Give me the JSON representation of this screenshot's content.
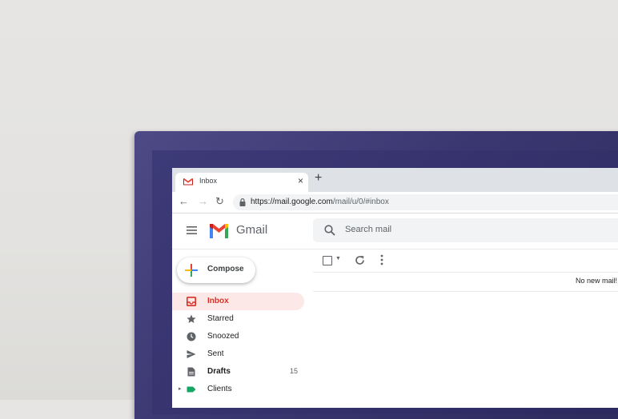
{
  "browser": {
    "tab_title": "Inbox",
    "tab_close": "×",
    "new_tab": "+",
    "url_main": "https://mail.google.com",
    "url_path": "/mail/u/0/#inbox",
    "nav_back": "←",
    "nav_forward": "→",
    "nav_reload": "↻"
  },
  "gmail": {
    "app_name": "Gmail",
    "search_placeholder": "Search mail",
    "compose_label": "Compose",
    "empty_message": "No new mail!"
  },
  "sidebar": {
    "items": [
      {
        "label": "Inbox",
        "icon": "inbox-icon",
        "active": true
      },
      {
        "label": "Starred",
        "icon": "star-icon"
      },
      {
        "label": "Snoozed",
        "icon": "clock-icon"
      },
      {
        "label": "Sent",
        "icon": "send-icon"
      },
      {
        "label": "Drafts",
        "icon": "draft-icon",
        "count": "15"
      },
      {
        "label": "Clients",
        "icon": "label-icon",
        "expand": "▸"
      }
    ]
  },
  "colors": {
    "accent_red": "#d93025",
    "active_bg": "#fce8e6",
    "bezel": "#3a3670",
    "label_green": "#16a765"
  }
}
